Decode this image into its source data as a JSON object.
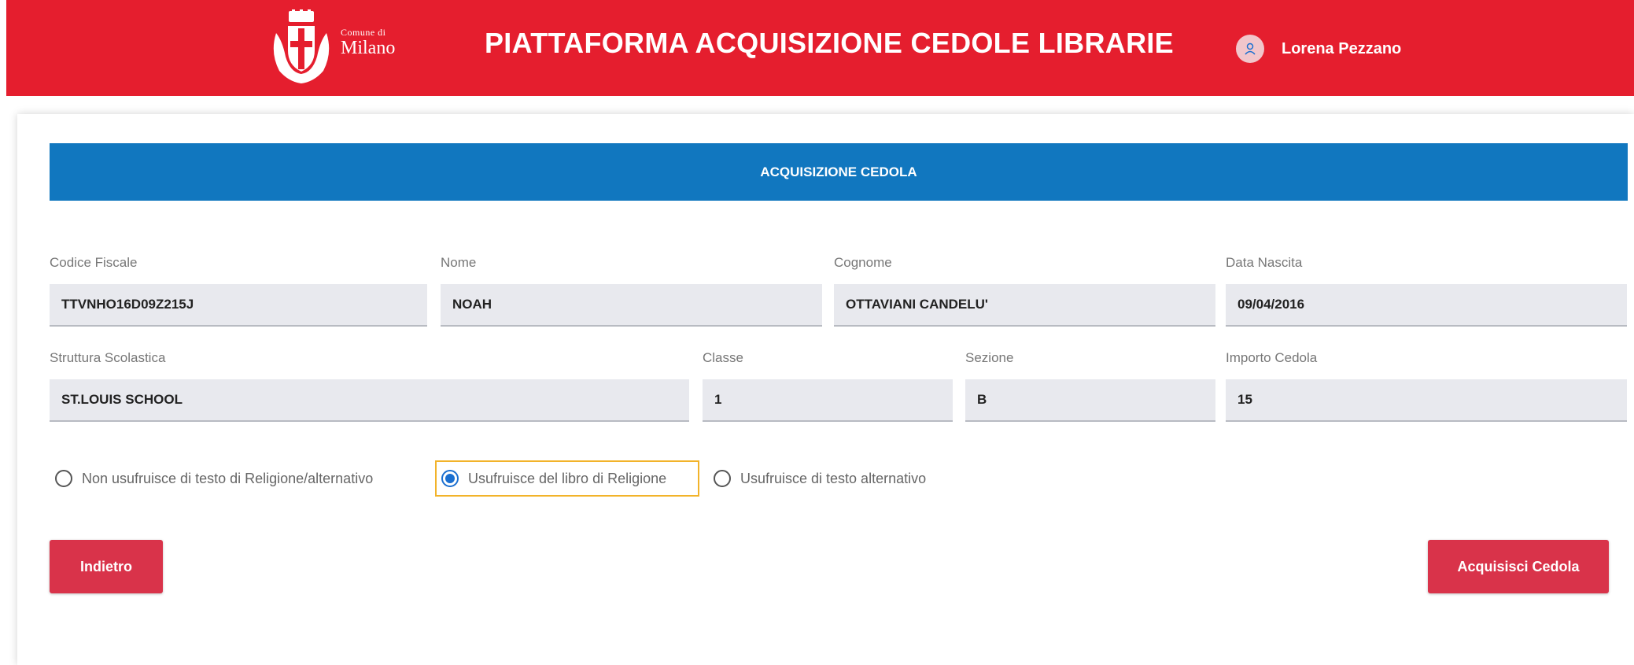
{
  "header": {
    "logo_small": "Comune di",
    "logo_big": "Milano",
    "title": "PIATTAFORMA ACQUISIZIONE CEDOLE LIBRARIE",
    "user_name": "Lorena Pezzano"
  },
  "section": {
    "title": "ACQUISIZIONE CEDOLA"
  },
  "fields": {
    "codice_fiscale": {
      "label": "Codice Fiscale",
      "value": "TTVNHO16D09Z215J"
    },
    "nome": {
      "label": "Nome",
      "value": "NOAH"
    },
    "cognome": {
      "label": "Cognome",
      "value": "OTTAVIANI CANDELU'"
    },
    "data_nascita": {
      "label": "Data Nascita",
      "value": "09/04/2016"
    },
    "struttura": {
      "label": "Struttura Scolastica",
      "value": "ST.LOUIS SCHOOL"
    },
    "classe": {
      "label": "Classe",
      "value": "1"
    },
    "sezione": {
      "label": "Sezione",
      "value": "B"
    },
    "importo": {
      "label": "Importo Cedola",
      "value": "15"
    }
  },
  "religion_options": [
    {
      "label": "Non usufruisce di testo di Religione/alternativo",
      "checked": false
    },
    {
      "label": "Usufruisce del libro di Religione",
      "checked": true
    },
    {
      "label": "Usufruisce di testo alternativo",
      "checked": false
    }
  ],
  "buttons": {
    "back": "Indietro",
    "acquire": "Acquisisci Cedola"
  },
  "colors": {
    "header_red": "#e51e2e",
    "section_blue": "#1177bf",
    "button_red": "#d9334a",
    "focus_outline": "#f2b32a",
    "radio_selected": "#1a6fd0"
  }
}
